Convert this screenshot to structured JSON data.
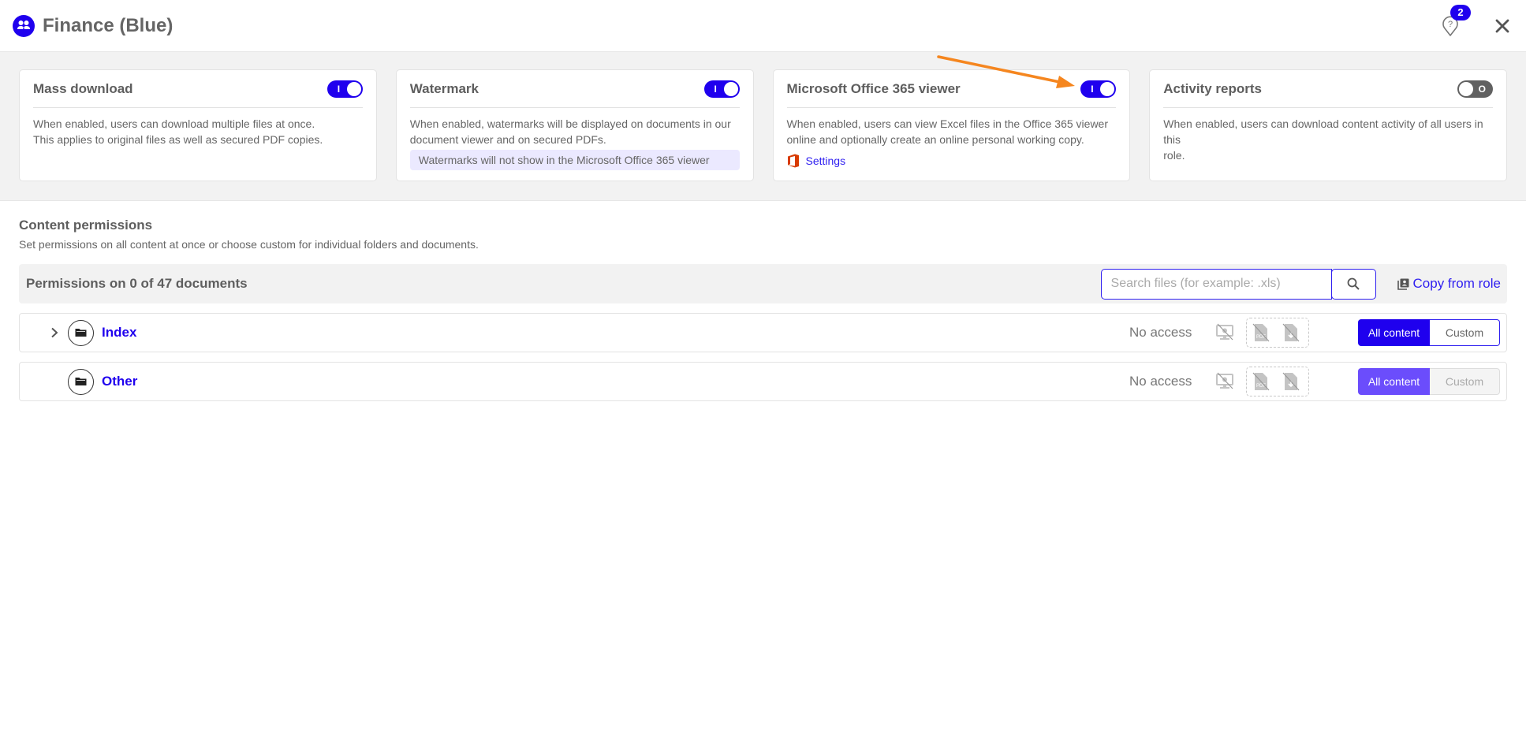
{
  "header": {
    "title": "Finance (Blue)",
    "role_icon": "users-group-icon",
    "help_badge_count": "2",
    "help_icon": "help-pin-icon",
    "close_icon": "close-icon"
  },
  "colors": {
    "accent": "#1f00ee",
    "toggle_off": "#616161",
    "notice_bg": "#ebe9ff",
    "annotation_arrow": "#f5861f",
    "office_red": "#d83b01"
  },
  "settings": [
    {
      "title": "Mass download",
      "enabled": true,
      "toggle_mark": "I",
      "description_lines": [
        "When enabled, users can download multiple files at once.",
        "This applies to original files as well as secured PDF copies."
      ]
    },
    {
      "title": "Watermark",
      "enabled": true,
      "toggle_mark": "I",
      "description_lines": [
        "When enabled, watermarks will be displayed on documents in our",
        "document viewer and on secured PDFs."
      ],
      "notice": "Watermarks will not show in the Microsoft Office 365 viewer"
    },
    {
      "title": "Microsoft Office 365 viewer",
      "enabled": true,
      "toggle_mark": "I",
      "description_lines": [
        "When enabled, users can view Excel files in the Office 365 viewer",
        "online and optionally create an online personal working copy."
      ],
      "link_label": "Settings",
      "link_icon": "office-icon"
    },
    {
      "title": "Activity reports",
      "enabled": false,
      "toggle_mark": "O",
      "description_lines": [
        "When enabled, users can download content activity of all users in this",
        "role."
      ]
    }
  ],
  "content_permissions": {
    "title": "Content permissions",
    "description": "Set permissions on all content at once or choose custom for individual folders and documents.",
    "count_label": "Permissions on 0 of 47 documents",
    "search": {
      "placeholder": "Search files (for example: .xls)",
      "value": ""
    },
    "copy_from_role_label": "Copy from role",
    "rows": [
      {
        "name": "Index",
        "expandable": true,
        "access": "No access",
        "all_content_label": "All content",
        "custom_label": "Custom",
        "mode": "all",
        "active": true
      },
      {
        "name": "Other",
        "expandable": false,
        "access": "No access",
        "all_content_label": "All content",
        "custom_label": "Custom",
        "mode": "all",
        "active": false
      }
    ]
  }
}
